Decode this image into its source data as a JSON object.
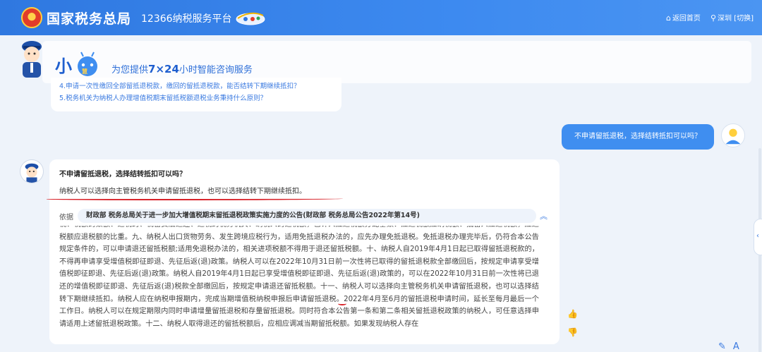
{
  "header": {
    "site_title": "国家税务总局",
    "platform": "12366纳税服务平台",
    "nav": {
      "home": "返回首页",
      "city": "深圳",
      "switch": "[切换]"
    }
  },
  "assistant": {
    "name": "小慧",
    "tagline_prefix": "为您提供",
    "tagline_bold": "7×24",
    "tagline_suffix": "小时智能咨询服务"
  },
  "suggestions": [
    "4.申请一次性缴回全部留抵退税款，缴回的留抵退税款，能否结转下期继续抵扣？",
    "5.税务机关为纳税人办理增值税期末留抵税额退税业务秉持什么原则？"
  ],
  "user_message": "不申请留抵退税，选择结转抵扣可以吗？",
  "answer": {
    "question": "不申请留抵退税，选择结转抵扣可以吗？",
    "text": "纳税人可以选择向主管税务机关申请留抵退税，也可以选择结转下期继续抵扣。",
    "basis_label": "依据",
    "basis_doc": "财政部 税务总局关于进一步加大增值税期末留抵退税政策实施力度的公告(财政部 税务总局公告2022年第14号)",
    "doc_before": "税、税额的数额、退税的、税留费后退还、退税的税务机关、纳税人的退税额，已计人应退税额分配基数、应退税额应纳税额、抵留人应退税额，应退税额应退税额的比重。九、纳税人出口货物劳务、发生跨境应税行为，适用免抵退税办法的，应先办理免抵退税。免抵退税办理完毕后，仍符合本公告规定条件的，可以申请退还留抵税额;适用免退税办法的，相关进项税额不得用于退还留抵税额。十、纳税人自2019年4月1日起已取得留抵退税款的，不得再申请享受增值税即征即退、先征后返(退)政策。纳税人可以在2022年10月31日前一次性将已取得的留抵退税款全部缴回后，按规定申请享受增值税即征即退、先征后返(退)政策。纳税人自2019年4月1日起已享受增值税即征即退、先征后返(退)政策的，可以在2022年10月31日前一次性将已退还的增值税即征即退、先征后返(退)税款全部缴回后，按规定申请退还留抵税额。十一、",
    "doc_highlight": "纳税人可以选择向主管税务机关申请留抵退税，也可以选择结转下期继续抵扣。",
    "doc_after": "纳税人应在纳税申报期内，完成当期增值税纳税申报后申请留抵退税。2022年4月至6月的留抵退税申请时间，延长至每月最后一个工作日。纳税人可以在规定期限内同时申请增量留抵退税和存量留抵退税。同时符合本公告第一条和第二条相关留抵退税政策的纳税人，可任意选择申请适用上述留抵退税政策。十二、纳税人取得退还的留抵税额后，应相应调减当期留抵税额。如果发现纳税人存在"
  },
  "colors": {
    "brand": "#2f78e0",
    "highlight_underline": "#d8232a"
  }
}
